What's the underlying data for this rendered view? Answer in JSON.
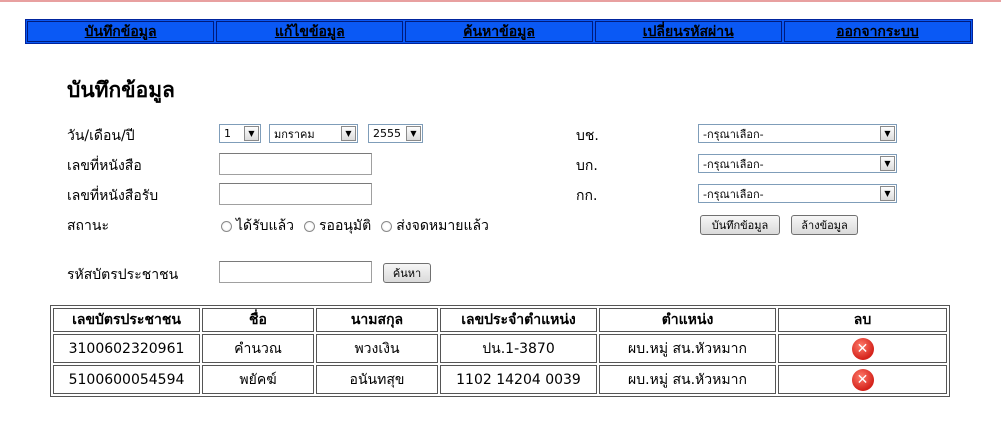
{
  "nav": {
    "items": [
      {
        "label": "บันทึกข้อมูล"
      },
      {
        "label": "แก้ไขข้อมูล"
      },
      {
        "label": "ค้นหาข้อมูล"
      },
      {
        "label": "เปลี่ยนรหัสผ่าน"
      },
      {
        "label": "ออกจากระบบ"
      }
    ]
  },
  "page_title": "บันทึกข้อมูล",
  "form": {
    "date_label": "วัน/เดือน/ปี",
    "day_value": "1",
    "month_value": "มกราคม",
    "year_value": "2555",
    "doc_no_label": "เลขที่หนังสือ",
    "recv_no_label": "เลขที่หนังสือรับ",
    "status_label": "สถานะ",
    "status_options": [
      "ได้รับแล้ว",
      "รออนุมัติ",
      "ส่งจดหมายแล้ว"
    ],
    "bch_label": "บช.",
    "bk_label": "บก.",
    "kk_label": "กก.",
    "select_placeholder": "-กรุณาเลือก-",
    "save_button": "บันทึกข้อมูล",
    "clear_button": "ล้างข้อมูล",
    "id_card_label": "รหัสบัตรประชาชน",
    "search_button": "ค้นหา"
  },
  "table": {
    "headers": [
      "เลขบัตรประชาชน",
      "ชื่อ",
      "นามสกุล",
      "เลขประจำตำแหน่ง",
      "ตำแหน่ง",
      "ลบ"
    ],
    "rows": [
      [
        "3100602320961",
        "คำนวณ",
        "พวงเงิน",
        "ปน.1-3870",
        "ผบ.หมู่ สน.หัวหมาก"
      ],
      [
        "5100600054594",
        "พยัคฆ์",
        "อนันทสุข",
        "1102 14204 0039",
        "ผบ.หมู่ สน.หัวหมาก"
      ]
    ],
    "delete_icon": "delete-icon"
  },
  "colors": {
    "nav_bg": "#0a59f5",
    "delete_red": "#d4221a"
  }
}
